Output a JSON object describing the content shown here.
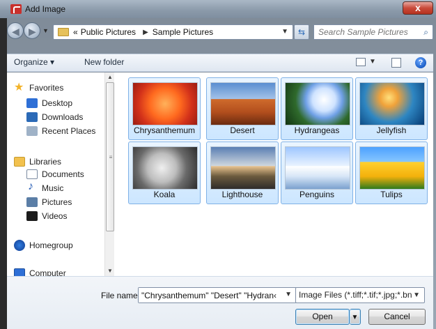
{
  "window": {
    "title": "Add Image",
    "close_label": "x"
  },
  "address": {
    "crumbs": [
      "«",
      "Public Pictures",
      "Sample Pictures"
    ],
    "search_placeholder": "Search Sample Pictures"
  },
  "toolbar": {
    "organize_label": "Organize ▾",
    "new_folder_label": "New folder",
    "help_label": "?"
  },
  "sidebar": {
    "favorites": {
      "label": "Favorites",
      "items": [
        "Desktop",
        "Downloads",
        "Recent Places"
      ]
    },
    "libraries": {
      "label": "Libraries",
      "items": [
        "Documents",
        "Music",
        "Pictures",
        "Videos"
      ]
    },
    "homegroup_label": "Homegroup",
    "computer_label": "Computer"
  },
  "files": [
    {
      "name": "Chrysanthemum",
      "selected": true
    },
    {
      "name": "Desert",
      "selected": true
    },
    {
      "name": "Hydrangeas",
      "selected": true
    },
    {
      "name": "Jellyfish",
      "selected": true
    },
    {
      "name": "Koala",
      "selected": true
    },
    {
      "name": "Lighthouse",
      "selected": true
    },
    {
      "name": "Penguins",
      "selected": true
    },
    {
      "name": "Tulips",
      "selected": true
    }
  ],
  "bottom": {
    "file_name_label": "File name:",
    "file_name_value": "\"Chrysanthemum\" \"Desert\" \"Hydran‹",
    "file_type_value": "Image Files (*.tiff;*.tif;*.jpg;*.bn",
    "open_label": "Open",
    "cancel_label": "Cancel"
  },
  "icons": {
    "app": "app-logo-icon",
    "back": "back-arrow-icon",
    "forward": "forward-arrow-icon",
    "folder": "folder-icon",
    "refresh": "refresh-icon",
    "search": "search-icon",
    "view": "view-options-icon",
    "preview": "preview-pane-icon",
    "help": "help-icon"
  },
  "colors": {
    "selection_fill": "#cce6ff",
    "selection_border": "#7fb1e6",
    "title_close": "#c94a3a"
  }
}
